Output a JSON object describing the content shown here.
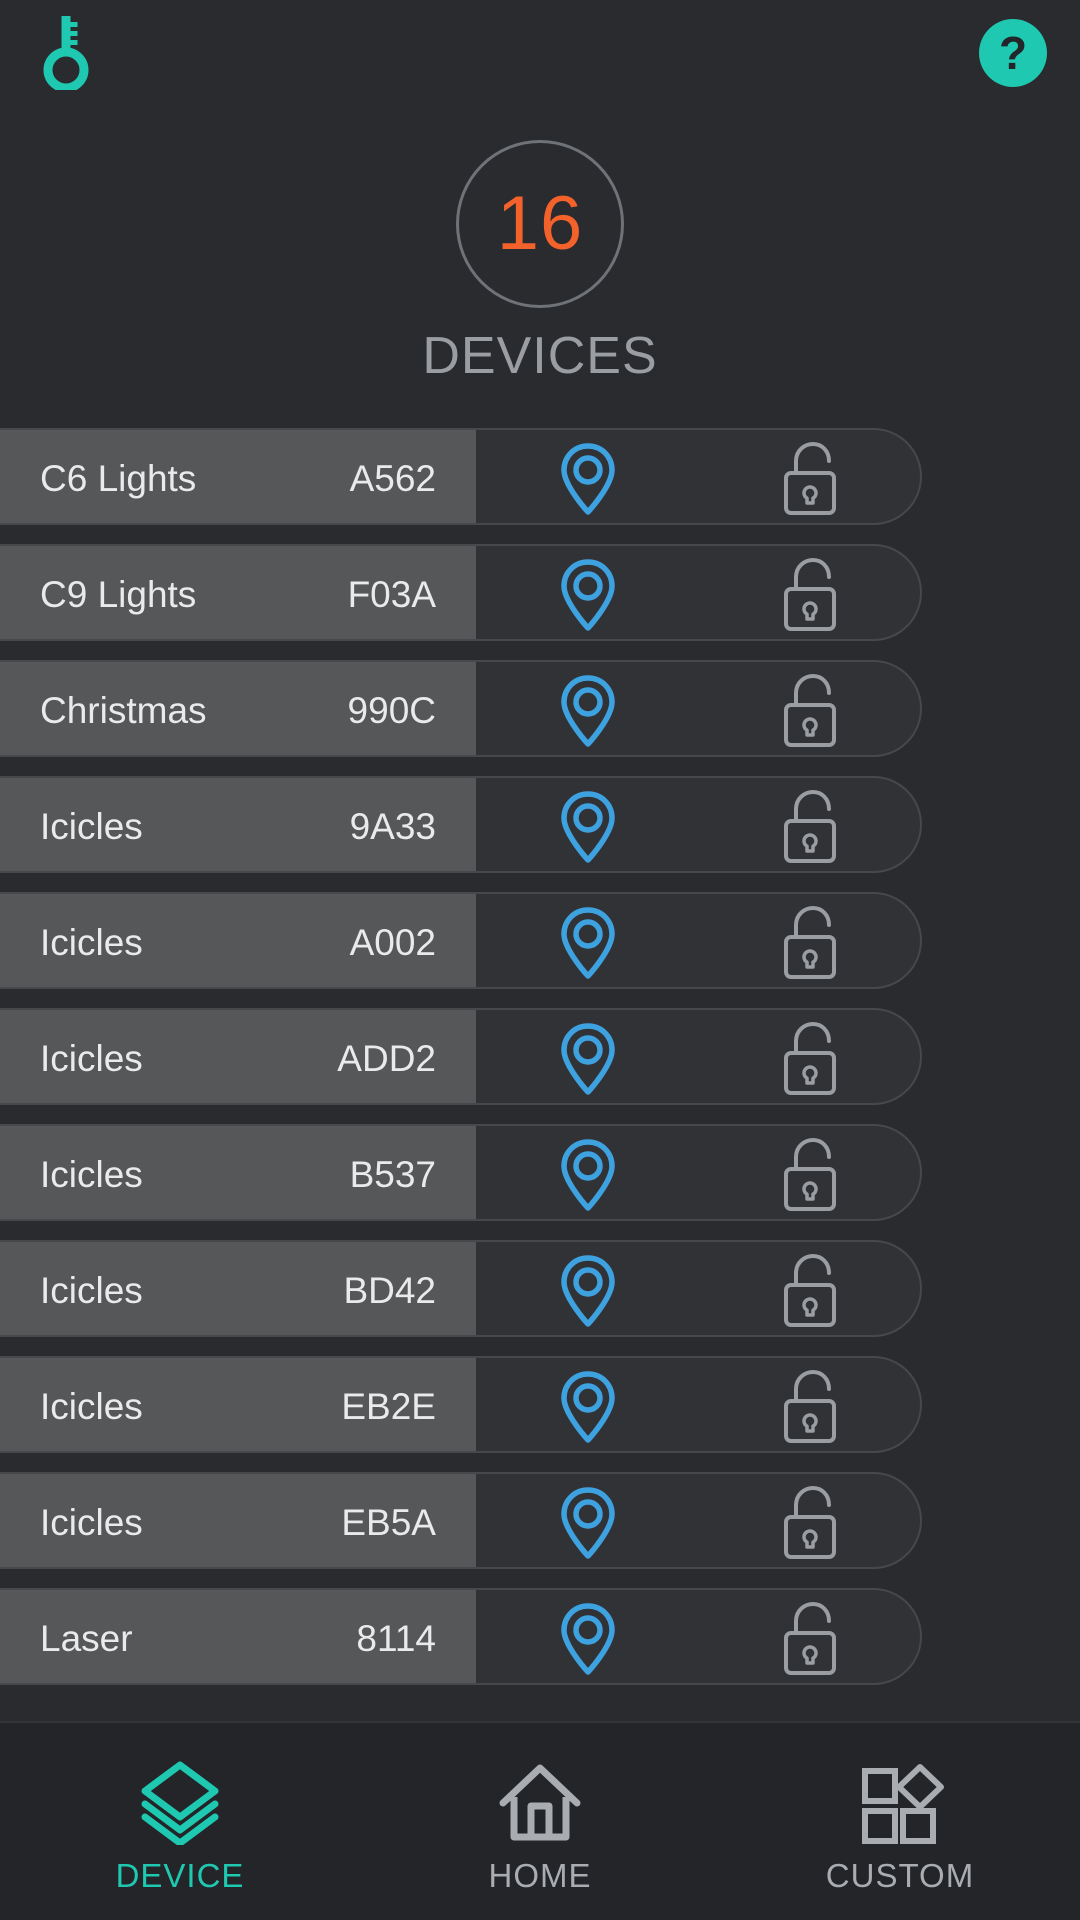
{
  "theme": {
    "background": "#292b2f",
    "accent_teal": "#1fc8b0",
    "accent_orange": "#f4622c",
    "pin_blue": "#3fa2e0",
    "row_left_bg": "#555759",
    "row_right_bg": "#303236",
    "text_primary": "#e9eaec",
    "text_muted": "#9a9da1"
  },
  "topbar": {
    "key_icon": "key-icon",
    "help_icon": "help-icon"
  },
  "counter": {
    "value": "16",
    "label": "DEVICES"
  },
  "devices": [
    {
      "name": "C6 Lights",
      "id": "A562",
      "locate_icon": "location-pin-icon",
      "lock_icon": "unlocked-padlock-icon"
    },
    {
      "name": "C9 Lights",
      "id": "F03A",
      "locate_icon": "location-pin-icon",
      "lock_icon": "unlocked-padlock-icon"
    },
    {
      "name": "Christmas",
      "id": "990C",
      "locate_icon": "location-pin-icon",
      "lock_icon": "unlocked-padlock-icon"
    },
    {
      "name": "Icicles",
      "id": "9A33",
      "locate_icon": "location-pin-icon",
      "lock_icon": "unlocked-padlock-icon"
    },
    {
      "name": "Icicles",
      "id": "A002",
      "locate_icon": "location-pin-icon",
      "lock_icon": "unlocked-padlock-icon"
    },
    {
      "name": "Icicles",
      "id": "ADD2",
      "locate_icon": "location-pin-icon",
      "lock_icon": "unlocked-padlock-icon"
    },
    {
      "name": "Icicles",
      "id": "B537",
      "locate_icon": "location-pin-icon",
      "lock_icon": "unlocked-padlock-icon"
    },
    {
      "name": "Icicles",
      "id": "BD42",
      "locate_icon": "location-pin-icon",
      "lock_icon": "unlocked-padlock-icon"
    },
    {
      "name": "Icicles",
      "id": "EB2E",
      "locate_icon": "location-pin-icon",
      "lock_icon": "unlocked-padlock-icon"
    },
    {
      "name": "Icicles",
      "id": "EB5A",
      "locate_icon": "location-pin-icon",
      "lock_icon": "unlocked-padlock-icon"
    },
    {
      "name": "Laser",
      "id": "8114",
      "locate_icon": "location-pin-icon",
      "lock_icon": "unlocked-padlock-icon"
    }
  ],
  "bottom_nav": {
    "items": [
      {
        "label": "DEVICE",
        "icon": "layers-icon",
        "active": true
      },
      {
        "label": "HOME",
        "icon": "home-icon",
        "active": false
      },
      {
        "label": "CUSTOM",
        "icon": "shapes-icon",
        "active": false
      }
    ]
  }
}
